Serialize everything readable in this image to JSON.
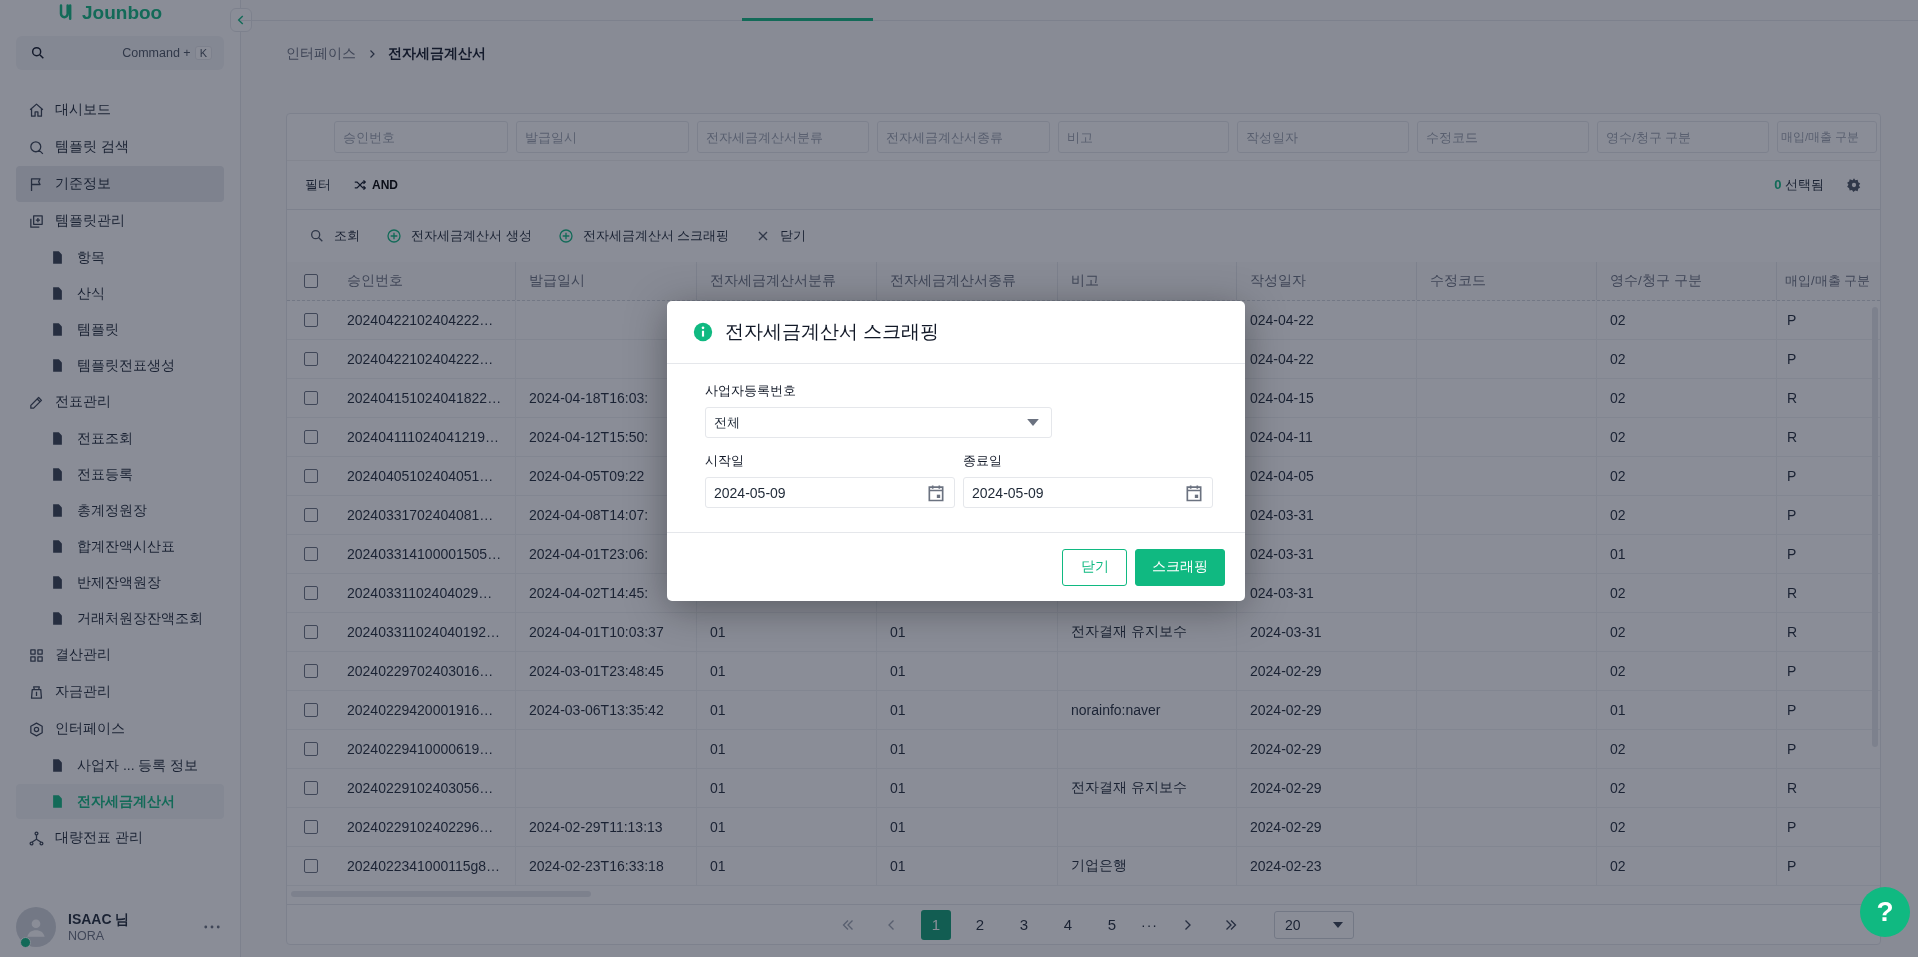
{
  "logo": "Jounboo",
  "sidebar": {
    "search": {
      "hint": "Command +",
      "key": "K"
    },
    "items": [
      {
        "label": "대시보드",
        "selected": false,
        "highlighted": false
      },
      {
        "label": "템플릿 검색",
        "selected": false,
        "highlighted": false
      },
      {
        "label": "기준정보",
        "selected": false,
        "highlighted": true
      },
      {
        "label": "템플릿관리",
        "selected": false,
        "highlighted": false,
        "children": [
          {
            "label": "항목",
            "selected": false
          },
          {
            "label": "산식",
            "selected": false
          },
          {
            "label": "템플릿",
            "selected": false
          },
          {
            "label": "템플릿전표생성",
            "selected": false
          }
        ]
      },
      {
        "label": "전표관리",
        "selected": false,
        "highlighted": false,
        "children": [
          {
            "label": "전표조회",
            "selected": false
          },
          {
            "label": "전표등록",
            "selected": false
          },
          {
            "label": "총계정원장",
            "selected": false
          },
          {
            "label": "합계잔액시산표",
            "selected": false
          },
          {
            "label": "반제잔액원장",
            "selected": false
          },
          {
            "label": "거래처원장잔액조회",
            "selected": false
          }
        ]
      },
      {
        "label": "결산관리",
        "selected": false,
        "highlighted": false
      },
      {
        "label": "자금관리",
        "selected": false,
        "highlighted": false
      },
      {
        "label": "인터페이스",
        "selected": false,
        "highlighted": false,
        "children": [
          {
            "label": "사업자 ...  등록 정보",
            "selected": false
          },
          {
            "label": "전자세금계산서",
            "selected": true
          }
        ]
      },
      {
        "label": "대량전표 관리",
        "selected": false,
        "highlighted": false
      }
    ],
    "user": {
      "name": "ISAAC 님",
      "org": "NORA",
      "online": true
    }
  },
  "breadcrumb": [
    "인터페이스",
    "전자세금계산서"
  ],
  "filter_bar": {
    "label": "필터",
    "mode": "AND",
    "selected_count": "0",
    "selected_label": "선택됨"
  },
  "toolbar": [
    {
      "kind": "search",
      "label": "조회"
    },
    {
      "kind": "add",
      "label": "전자세금계산서 생성"
    },
    {
      "kind": "add",
      "label": "전자세금계산서 스크래핑"
    },
    {
      "kind": "close",
      "label": "닫기"
    }
  ],
  "table": {
    "all_checked": false,
    "columns": [
      {
        "label": "승인번호",
        "placeholder": "승인번호"
      },
      {
        "label": "발급일시",
        "placeholder": "발급일시"
      },
      {
        "label": "전자세금계산서분류",
        "placeholder": "전자세금계산서분류"
      },
      {
        "label": "전자세금계산서종류",
        "placeholder": "전자세금계산서종류"
      },
      {
        "label": "비고",
        "placeholder": "비고"
      },
      {
        "label": "작성일자",
        "placeholder": "작성일자"
      },
      {
        "label": "수정코드",
        "placeholder": "수정코드"
      },
      {
        "label": "영수/청구 구분",
        "placeholder": "영수/청구 구분"
      },
      {
        "label": "매입/매출 구분",
        "placeholder": "매입/매출 구분"
      }
    ],
    "rows": [
      {
        "checked": false,
        "cells": [
          "20240422102404222…",
          null,
          null,
          null,
          null,
          "024-04-22",
          null,
          "02",
          "P"
        ]
      },
      {
        "checked": false,
        "cells": [
          "20240422102404222…",
          null,
          null,
          null,
          null,
          "024-04-22",
          null,
          "02",
          "P"
        ]
      },
      {
        "checked": false,
        "cells": [
          "202404151024041822…",
          "2024-04-18T16:03:",
          null,
          null,
          null,
          "024-04-15",
          null,
          "02",
          "R"
        ]
      },
      {
        "checked": false,
        "cells": [
          "202404111024041219…",
          "2024-04-12T15:50:",
          null,
          null,
          null,
          "024-04-11",
          null,
          "02",
          "R"
        ]
      },
      {
        "checked": false,
        "cells": [
          "20240405102404051…",
          "2024-04-05T09:22",
          null,
          null,
          null,
          "024-04-05",
          null,
          "02",
          "P"
        ]
      },
      {
        "checked": false,
        "cells": [
          "20240331702404081…",
          "2024-04-08T14:07:",
          null,
          null,
          null,
          "024-03-31",
          null,
          "02",
          "P"
        ]
      },
      {
        "checked": false,
        "cells": [
          "202403314100001505…",
          "2024-04-01T23:06:",
          null,
          null,
          null,
          "024-03-31",
          null,
          "01",
          "P"
        ]
      },
      {
        "checked": false,
        "cells": [
          "20240331102404029…",
          "2024-04-02T14:45:",
          null,
          null,
          null,
          "024-03-31",
          null,
          "02",
          "R"
        ]
      },
      {
        "checked": false,
        "cells": [
          "202403311024040192…",
          "2024-04-01T10:03:37",
          "01",
          "01",
          "전자결재 유지보수",
          "2024-03-31",
          null,
          "02",
          "R"
        ]
      },
      {
        "checked": false,
        "cells": [
          "20240229702403016…",
          "2024-03-01T23:48:45",
          "01",
          "01",
          null,
          "2024-02-29",
          null,
          "02",
          "P"
        ]
      },
      {
        "checked": false,
        "cells": [
          "20240229420001916…",
          "2024-03-06T13:35:42",
          "01",
          "01",
          "norainfo:naver",
          "2024-02-29",
          null,
          "01",
          "P"
        ]
      },
      {
        "checked": false,
        "cells": [
          "20240229410000619…",
          null,
          "01",
          "01",
          null,
          "2024-02-29",
          null,
          "02",
          "P"
        ]
      },
      {
        "checked": false,
        "cells": [
          "20240229102403056…",
          null,
          "01",
          "01",
          "전자결재 유지보수",
          "2024-02-29",
          null,
          "02",
          "R"
        ]
      },
      {
        "checked": false,
        "cells": [
          "20240229102402296…",
          "2024-02-29T11:13:13",
          "01",
          "01",
          null,
          "2024-02-29",
          null,
          "02",
          "P"
        ]
      },
      {
        "checked": false,
        "cells": [
          "2024022341000115g8…",
          "2024-02-23T16:33:18",
          "01",
          "01",
          "기업은행",
          "2024-02-23",
          null,
          "02",
          "P"
        ]
      }
    ]
  },
  "pagination": {
    "pages": [
      {
        "label": "1",
        "selected": true
      },
      {
        "label": "2",
        "selected": false
      },
      {
        "label": "3",
        "selected": false
      },
      {
        "label": "4",
        "selected": false
      },
      {
        "label": "5",
        "selected": false
      }
    ],
    "ellipsis": "···",
    "page_size": "20"
  },
  "modal": {
    "title": "전자세금계산서 스크래핑",
    "business_no": {
      "label": "사업자등록번호",
      "value": "전체"
    },
    "start_date": {
      "label": "시작일",
      "value": "2024-05-09"
    },
    "end_date": {
      "label": "종료일",
      "value": "2024-05-09"
    },
    "buttons": [
      {
        "kind": "secondary",
        "label": "닫기"
      },
      {
        "kind": "primary",
        "label": "스크래핑"
      }
    ]
  },
  "help_button": {
    "label": "?"
  }
}
